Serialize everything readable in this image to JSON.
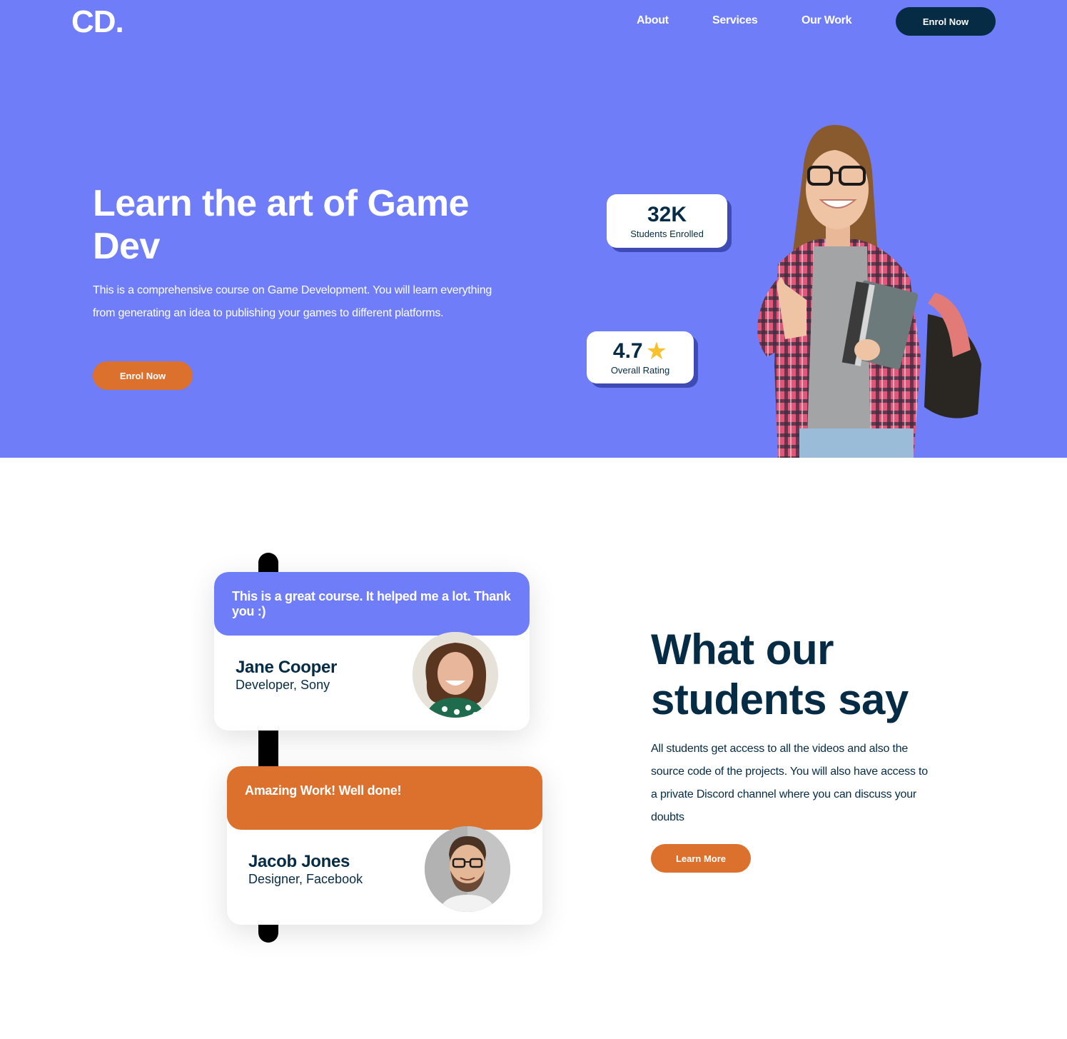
{
  "header": {
    "logo": "CD.",
    "nav": [
      {
        "label": "About"
      },
      {
        "label": "Services"
      },
      {
        "label": "Our Work"
      }
    ],
    "cta_label": "Enrol Now"
  },
  "hero": {
    "title": "Learn the art of Game Dev",
    "description": "This is a comprehensive course on Game Development. You will learn everything from generating an idea to publishing your games to different platforms.",
    "cta_label": "Enrol Now",
    "stats": {
      "students": {
        "value": "32K",
        "label": "Students Enrolled"
      },
      "rating": {
        "value": "4.7",
        "label": "Overall Rating",
        "icon": "star-icon"
      }
    }
  },
  "testimonials": [
    {
      "quote": "This is a great course. It helped me a lot. Thank you :)",
      "name": "Jane Cooper",
      "role": "Developer, Sony",
      "color": "#6f7ef8"
    },
    {
      "quote": "Amazing Work! Well done!",
      "name": "Jacob Jones",
      "role": "Designer, Facebook",
      "color": "#dc702d"
    }
  ],
  "students_section": {
    "title": "What our students say",
    "description": "All students get access to all the videos and also the source code of the projects. You will also have access to a private Discord channel where you can discuss your doubts",
    "cta_label": "Learn More"
  },
  "colors": {
    "primary": "#6f7ef8",
    "accent": "#dc702d",
    "dark": "#062b44"
  }
}
